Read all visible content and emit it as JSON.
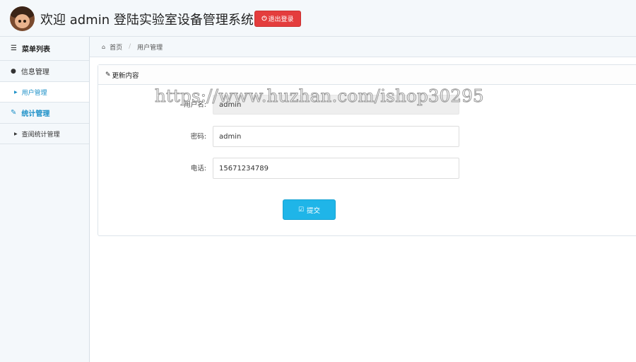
{
  "header": {
    "welcome_text": "欢迎 admin 登陆实验室设备管理系统",
    "logout_label": "退出登录"
  },
  "sidebar": {
    "title": "菜单列表",
    "groups": [
      {
        "label": "信息管理",
        "items": [
          {
            "label": "用户管理"
          }
        ]
      },
      {
        "label": "统计管理",
        "items": [
          {
            "label": "查阅统计管理"
          }
        ]
      }
    ]
  },
  "breadcrumb": {
    "home": "首页",
    "current": "用户管理"
  },
  "panel": {
    "title": "更新内容",
    "fields": [
      {
        "label": "用户名:",
        "value": "admin"
      },
      {
        "label": "密码:",
        "value": "admin"
      },
      {
        "label": "电话:",
        "value": "15671234789"
      }
    ],
    "submit_label": "提交"
  },
  "watermark": "https://www.huzhan.com/ishop30295",
  "colors": {
    "logout": "#e43d3d",
    "submit": "#1fb5e8",
    "active_menu": "#1a8fc7"
  }
}
